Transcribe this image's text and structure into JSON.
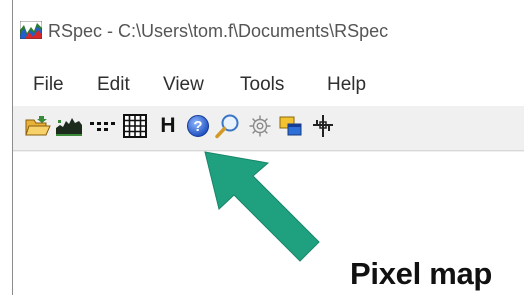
{
  "window": {
    "title": "RSpec - C:\\Users\\tom.f\\Documents\\RSpec"
  },
  "menu": {
    "items": [
      {
        "label": "File"
      },
      {
        "label": "Edit"
      },
      {
        "label": "View"
      },
      {
        "label": "Tools"
      },
      {
        "label": "Help"
      }
    ]
  },
  "toolbar": {
    "buttons": [
      {
        "icon": "open-folder-icon"
      },
      {
        "icon": "spectrum-profile-icon"
      },
      {
        "icon": "dotted-line-icon"
      },
      {
        "icon": "pixel-map-grid-icon"
      },
      {
        "icon": "header-h-icon",
        "label": "H"
      },
      {
        "icon": "help-icon"
      },
      {
        "icon": "magnifier-icon"
      },
      {
        "icon": "settings-gear-icon"
      },
      {
        "icon": "overlay-windows-icon"
      },
      {
        "icon": "crosshair-icon"
      }
    ]
  },
  "annotation": {
    "label": "Pixel map",
    "arrow_color": "#1fa07e"
  }
}
